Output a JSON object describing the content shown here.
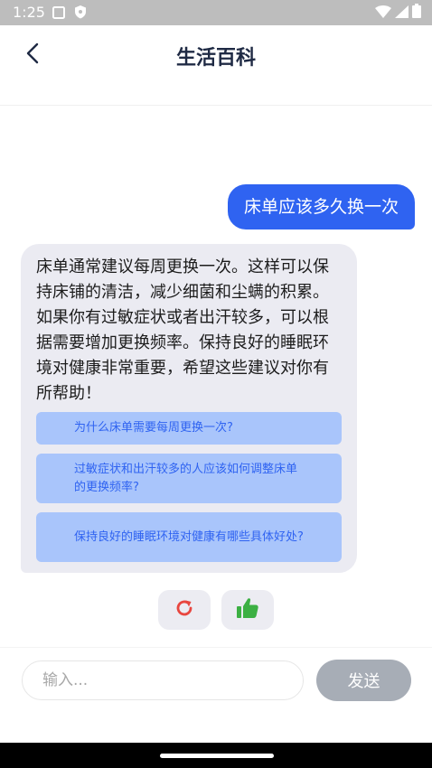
{
  "status": {
    "time": "1:25"
  },
  "header": {
    "title": "生活百科"
  },
  "chat": {
    "user_message": "床单应该多久换一次",
    "bot_message": "床单通常建议每周更换一次。这样可以保持床铺的清洁，减少细菌和尘螨的积累。如果你有过敏症状或者出汗较多，可以根据需要增加更换频率。保持良好的睡眠环境对健康非常重要，希望这些建议对你有所帮助！",
    "suggestions": [
      "为什么床单需要每周更换一次?",
      "过敏症状和出汗较多的人应该如何调整床单的更换频率?",
      "保持良好的睡眠环境对健康有哪些具体好处?"
    ]
  },
  "input": {
    "placeholder": "输入...",
    "send_label": "发送"
  },
  "colors": {
    "accent": "#2f63f1",
    "suggestion_bg": "#a9c5fb",
    "bot_bubble_bg": "#ebebf2",
    "refresh_icon": "#e8463f",
    "like_icon": "#3cb043",
    "send_disabled": "#a7adb6"
  },
  "icons": {
    "back": "chevron-left-icon",
    "refresh": "refresh-icon",
    "like": "thumbs-up-icon"
  }
}
